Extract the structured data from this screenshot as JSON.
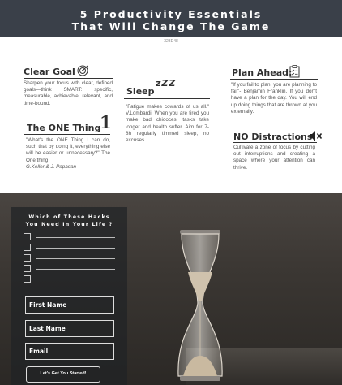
{
  "header": {
    "title": "5 Productivity Essentials\nThat Will Change The Game",
    "code": "323D48"
  },
  "sections": {
    "clear_goal": {
      "heading": "Clear Goal",
      "text": "Sharpen your focus with clear, defined goals—think SMART: specific, measurable, achievable, relevant, and time-bound."
    },
    "one_thing": {
      "heading": "The ONE Thing",
      "number": "1",
      "text": "\"What's the ONE Thing I can do, such that by doing it, everything else will be easier or unnecessary?\" The One thing",
      "author": "G.Keller & J. Papasan"
    },
    "sleep": {
      "heading": "Sleep",
      "zzz": "zZZ",
      "text": "\"Fatigue makes cowards of us all.\" V.Lombardi. When you are tired you make bad chiooces, tasks take longer and health suffer. Aim for 7-8h regularly timmed sleep, no excuses."
    },
    "plan_ahead": {
      "heading": "Plan Ahead:",
      "text": "\"If you fail to plan, you are planning to fail\"- Benjamin Franklin. If you don't have a plan for the day. You will end up doing things that are thrown at you externally."
    },
    "no_distractions": {
      "heading": "NO Distractions",
      "text": "Cultivate a zone of focus by cutting out interruptions and creating a space where your attention can thrive."
    }
  },
  "form": {
    "title": "Which of These Hacks\nYou  Need In Your Life ?",
    "fields": [
      "First Name",
      "Last Name",
      "Email"
    ],
    "button": "Let's Get You Started!"
  },
  "icons": {
    "goal": "target-icon",
    "plan": "checklist-icon",
    "distractions": "mute-icon"
  }
}
